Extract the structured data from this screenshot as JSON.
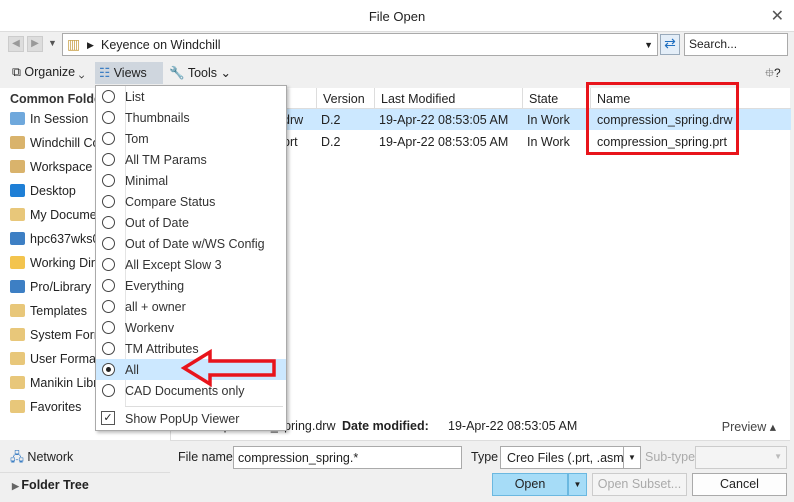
{
  "window": {
    "title": "File Open",
    "close": "✕"
  },
  "address": {
    "path": "Keyence on Windchill",
    "search_placeholder": "Search..."
  },
  "toolbar": {
    "organize": "Organize",
    "views": "Views",
    "tools": "Tools",
    "help": "⯐?"
  },
  "sidebar": {
    "header": "Common Folde",
    "items": [
      {
        "label": "In Session",
        "icon": "monitor-icon",
        "color": "#6fa8dc"
      },
      {
        "label": "Windchill Co",
        "icon": "windchill-icon",
        "color": "#d9b36c"
      },
      {
        "label": "Workspace",
        "icon": "workspace-icon",
        "color": "#d9b36c"
      },
      {
        "label": "Desktop",
        "icon": "desktop-icon",
        "color": "#1e7fd6"
      },
      {
        "label": "My Docume",
        "icon": "documents-icon",
        "color": "#e8c77a"
      },
      {
        "label": "hpc637wks0",
        "icon": "computer-icon",
        "color": "#3d7fc4"
      },
      {
        "label": "Working Dir",
        "icon": "folder-icon",
        "color": "#f3c44e"
      },
      {
        "label": "Pro/Library",
        "icon": "library-icon",
        "color": "#3d7fc4"
      },
      {
        "label": "Templates",
        "icon": "folder-icon",
        "color": "#e8c77a"
      },
      {
        "label": "System Form",
        "icon": "folder-icon",
        "color": "#e8c77a"
      },
      {
        "label": "User Format",
        "icon": "folder-icon",
        "color": "#e8c77a"
      },
      {
        "label": "Manikin Libr",
        "icon": "folder-icon",
        "color": "#e8c77a"
      },
      {
        "label": "Favorites",
        "icon": "favorites-icon",
        "color": "#e8c77a"
      }
    ],
    "network": "Network",
    "folder_tree": "Folder Tree"
  },
  "table": {
    "columns": [
      "Version",
      "Last Modified",
      "State",
      "Name"
    ],
    "rows": [
      {
        "partial": "drw",
        "version": "D.2",
        "modified": "19-Apr-22 08:53:05 AM",
        "state": "In Work",
        "name": "compression_spring.drw",
        "selected": true
      },
      {
        "partial": "prt",
        "version": "D.2",
        "modified": "19-Apr-22 08:53:05 AM",
        "state": "In Work",
        "name": "compression_spring.prt",
        "selected": false
      }
    ]
  },
  "views_menu": {
    "items": [
      {
        "label": "List",
        "checked": false
      },
      {
        "label": "Thumbnails",
        "checked": false
      },
      {
        "label": "Tom",
        "checked": false
      },
      {
        "label": "All TM Params",
        "checked": false
      },
      {
        "label": "Minimal",
        "checked": false
      },
      {
        "label": "Compare Status",
        "checked": false
      },
      {
        "label": "Out of Date",
        "checked": false
      },
      {
        "label": "Out of Date w/WS Config",
        "checked": false
      },
      {
        "label": "All Except Slow 3",
        "checked": false
      },
      {
        "label": "Everything",
        "checked": false
      },
      {
        "label": "all + owner",
        "checked": false
      },
      {
        "label": "Workenv",
        "checked": false
      },
      {
        "label": "TM Attributes",
        "checked": false
      },
      {
        "label": "All",
        "checked": true
      },
      {
        "label": "CAD Documents only",
        "checked": false
      }
    ],
    "show_popup": "Show PopUp Viewer",
    "show_popup_checked": true
  },
  "status": {
    "file": "compression_spring.drw",
    "date_label": "Date modified:",
    "date": "19-Apr-22 08:53:05 AM",
    "preview": "Preview ▴"
  },
  "bottom": {
    "file_name_label": "File name:",
    "file_name": "compression_spring.*",
    "type_label": "Type",
    "type": "Creo Files (.prt, .asm, .",
    "subtype_label": "Sub-type",
    "open": "Open",
    "open_subset": "Open Subset...",
    "cancel": "Cancel"
  },
  "colors": {
    "selection": "#cce8ff",
    "annotation": "#e8141b",
    "primary": "#a6dcf7"
  }
}
